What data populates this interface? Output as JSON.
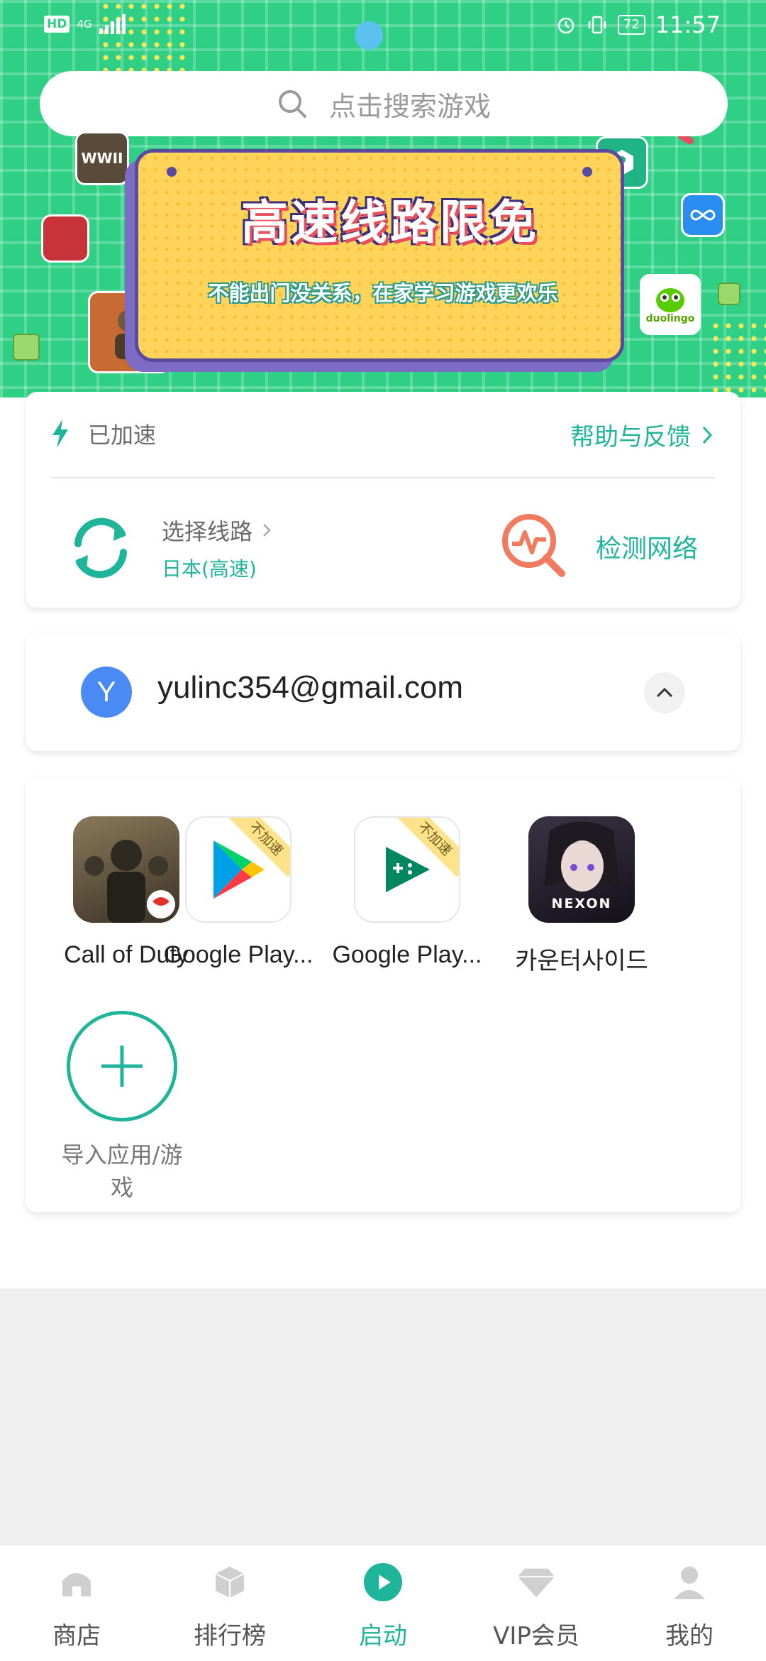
{
  "status_bar": {
    "hd": "HD",
    "network": "4G",
    "battery": "72",
    "time": "11:57"
  },
  "search": {
    "placeholder": "点击搜索游戏"
  },
  "banner": {
    "title": "高速线路限免",
    "subtitle": "不能出门没关系，在家学习游戏更欢乐",
    "tile_wwii": "WWII",
    "tile_duolingo": "duolingo"
  },
  "accel": {
    "status": "已加速",
    "help": "帮助与反馈",
    "route_label": "选择线路",
    "route_value": "日本(高速)",
    "detect": "检测网络"
  },
  "account": {
    "initial": "Y",
    "email": "yulinc354@gmail.com"
  },
  "apps": {
    "items": [
      {
        "name": "Call of Duty",
        "badge": ""
      },
      {
        "name": "Google Play...",
        "badge": "不加速"
      },
      {
        "name": "Google Play...",
        "badge": "不加速"
      },
      {
        "name": "카운터사이드",
        "badge": ""
      }
    ],
    "nexon": "NEXON",
    "add_label": "导入应用/游戏"
  },
  "nav": {
    "items": [
      {
        "label": "商店",
        "icon": "home-icon"
      },
      {
        "label": "排行榜",
        "icon": "cube-icon"
      },
      {
        "label": "启动",
        "icon": "play-icon"
      },
      {
        "label": "VIP会员",
        "icon": "diamond-icon"
      },
      {
        "label": "我的",
        "icon": "person-icon"
      }
    ]
  },
  "colors": {
    "accent": "#1fb59a",
    "banner_green": "#2fcf85",
    "avatar_blue": "#4a8af4"
  }
}
